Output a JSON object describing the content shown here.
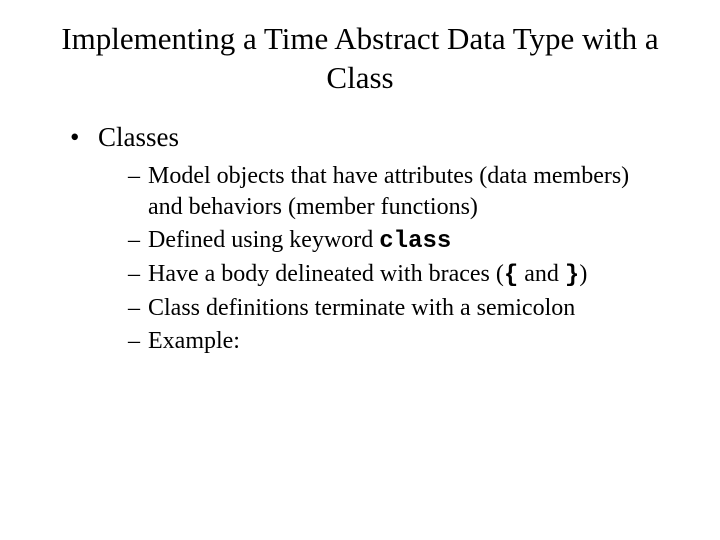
{
  "title": "Implementing a Time Abstract Data Type with a Class",
  "bullet1": "Classes",
  "sub1": "Model objects that have attributes (data members) and behaviors (member functions)",
  "sub2_pre": "Defined using keyword ",
  "sub2_code": "class",
  "sub3_pre": "Have a body delineated with braces (",
  "sub3_code1": "{",
  "sub3_mid": " and ",
  "sub3_code2": "}",
  "sub3_post": ")",
  "sub4": "Class definitions terminate with a semicolon",
  "sub5": "Example:"
}
